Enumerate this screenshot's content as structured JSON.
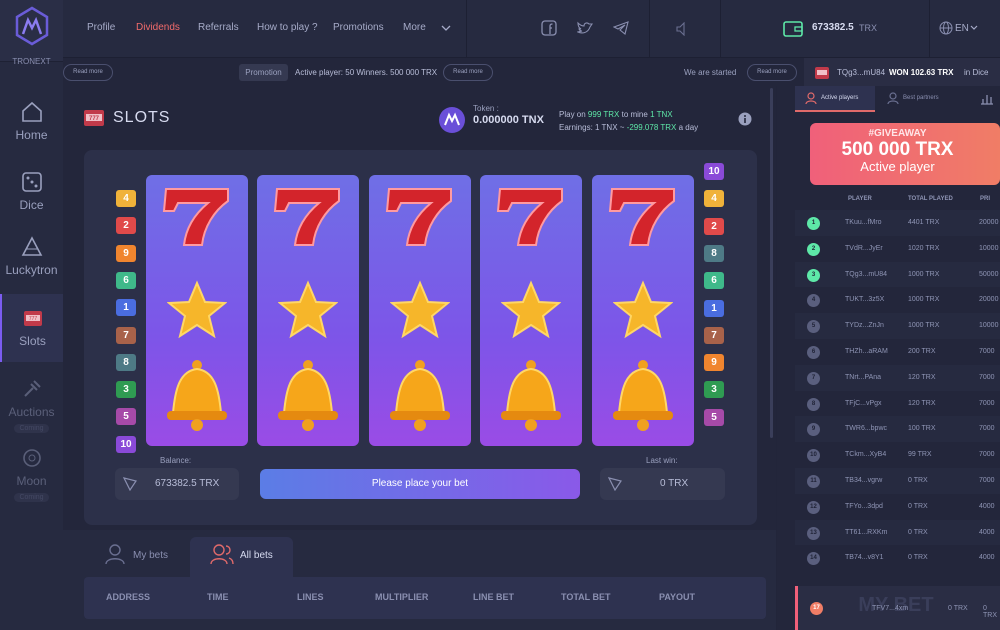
{
  "brand": {
    "name": "TRONEXT"
  },
  "sidebar": {
    "items": [
      {
        "label": "Home"
      },
      {
        "label": "Dice"
      },
      {
        "label": "Luckytron"
      },
      {
        "label": "Slots"
      },
      {
        "label": "Auctions",
        "badge": "Coming"
      },
      {
        "label": "Moon",
        "badge": "Coming"
      }
    ]
  },
  "topnav": {
    "items": [
      "Profile",
      "Dividends",
      "Referrals",
      "How to play ?",
      "Promotions",
      "More"
    ],
    "active": "Dividends"
  },
  "wallet": {
    "balance": "673382.5",
    "unit": "TRX"
  },
  "lang": "EN",
  "ticker": {
    "read_more": "Read more",
    "promotion_label": "Promotion",
    "promotion_text": "Active player: 50 Winners. 500 000 TRX",
    "started_text": "We are started",
    "win_user": "TQg3...mU84",
    "win_label": "WON 102.63 TRX",
    "win_suffix": "in Dice"
  },
  "slots": {
    "title": "SLOTS",
    "token_label": "Token :",
    "token_value": "0.000000 TNX",
    "play_line_prefix": "Play on",
    "play_amount": "999 TRX",
    "play_mid": "to mine",
    "play_mine": "1 TNX",
    "earnings_prefix": "Earnings: 1 TNX ~",
    "earnings_value": "-299.078 TRX",
    "earnings_suffix": "a day",
    "left_numbers": [
      "4",
      "2",
      "9",
      "6",
      "1",
      "7",
      "8",
      "3",
      "5",
      "10"
    ],
    "right_numbers": [
      "10",
      "4",
      "2",
      "8",
      "6",
      "1",
      "7",
      "9",
      "3",
      "5"
    ],
    "reel_symbols": [
      "seven",
      "star",
      "bell"
    ],
    "balance_label": "Balance:",
    "balance_value": "673382.5 TRX",
    "bet_button": "Please place your bet",
    "last_win_label": "Last win:",
    "last_win_value": "0 TRX"
  },
  "bets": {
    "tabs": [
      "My bets",
      "All bets"
    ],
    "active": "All bets",
    "columns": [
      "ADDRESS",
      "TIME",
      "LINES",
      "MULTIPLIER",
      "LINE BET",
      "TOTAL BET",
      "PAYOUT"
    ]
  },
  "right": {
    "tabs": [
      "Active players",
      "Best partners"
    ],
    "banner": {
      "tag": "#GIVEAWAY",
      "amount": "500 000 TRX",
      "sub": "Active player"
    },
    "columns": [
      "PLAYER",
      "TOTAL PLAYED",
      "PRI"
    ],
    "rows": [
      {
        "rank": "1",
        "player": "TKuu...fMro",
        "played": "4401 TRX",
        "prize": "20000"
      },
      {
        "rank": "2",
        "player": "TVdR...JyEr",
        "played": "1020 TRX",
        "prize": "10000"
      },
      {
        "rank": "3",
        "player": "TQg3...mU84",
        "played": "1000 TRX",
        "prize": "50000"
      },
      {
        "rank": "4",
        "player": "TUKT...3z5X",
        "played": "1000 TRX",
        "prize": "20000"
      },
      {
        "rank": "5",
        "player": "TYDz...ZnJn",
        "played": "1000 TRX",
        "prize": "10000"
      },
      {
        "rank": "6",
        "player": "THZh...aRAM",
        "played": "200 TRX",
        "prize": "7000"
      },
      {
        "rank": "7",
        "player": "TNrt...PAna",
        "played": "120 TRX",
        "prize": "7000"
      },
      {
        "rank": "8",
        "player": "TFjC...vPgx",
        "played": "120 TRX",
        "prize": "7000"
      },
      {
        "rank": "9",
        "player": "TWR6...bpwc",
        "played": "100 TRX",
        "prize": "7000"
      },
      {
        "rank": "10",
        "player": "TCkm...XyB4",
        "played": "99 TRX",
        "prize": "7000"
      },
      {
        "rank": "11",
        "player": "TB34...vgrw",
        "played": "0 TRX",
        "prize": "7000"
      },
      {
        "rank": "12",
        "player": "TFYo...3dpd",
        "played": "0 TRX",
        "prize": "4000"
      },
      {
        "rank": "13",
        "player": "TT61...RXKm",
        "played": "0 TRX",
        "prize": "4000"
      },
      {
        "rank": "14",
        "player": "TB74...v8Y1",
        "played": "0 TRX",
        "prize": "4000"
      }
    ],
    "footer": {
      "rank": "17",
      "player": "TFV7...4xm",
      "played": "0 TRX",
      "prize": "0 TRX",
      "watermark": "MY BET"
    }
  },
  "colors": {
    "accent": "#7b5cf0",
    "active_nav": "#f26b6b",
    "green": "#5ee8a8",
    "button_grad": "#8a59e8"
  }
}
